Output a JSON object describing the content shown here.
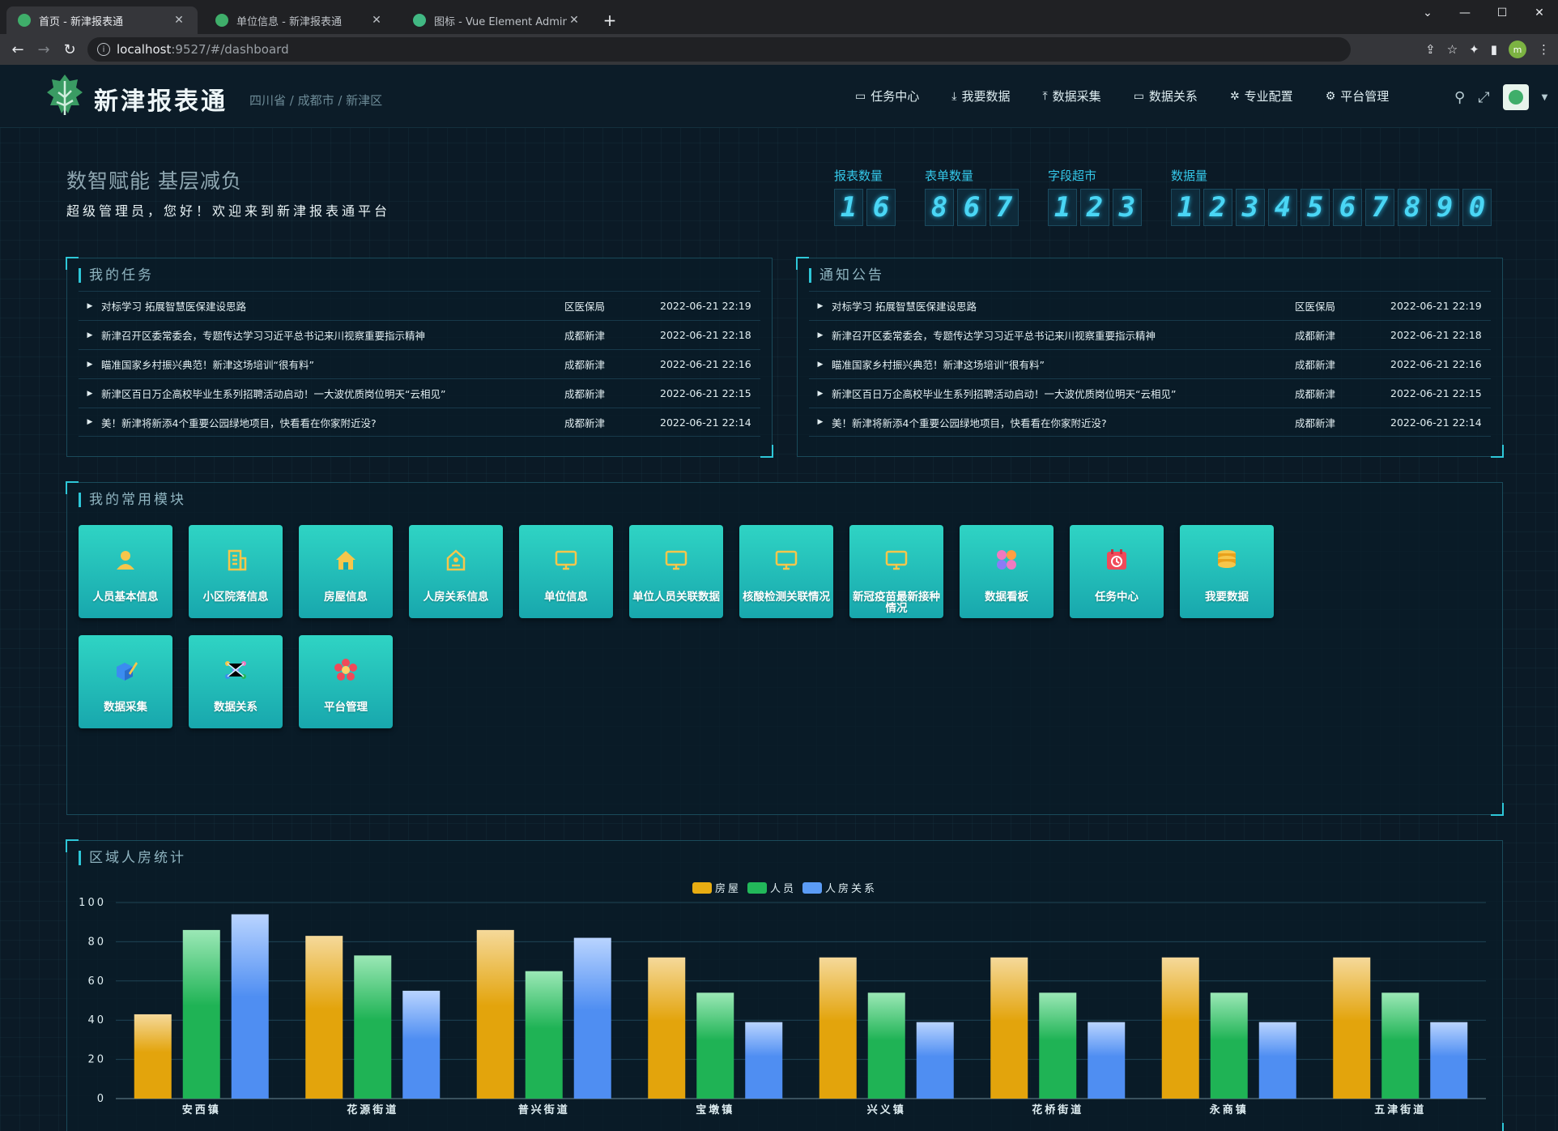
{
  "browser": {
    "tabs": [
      {
        "label": "首页 - 新津报表通",
        "active": true
      },
      {
        "label": "单位信息 - 新津报表通",
        "active": false
      },
      {
        "label": "图标 - Vue Element Admin",
        "active": false
      }
    ],
    "url_host": "localhost",
    "url_path": ":9527/#/dashboard",
    "profile_initial": "m"
  },
  "header": {
    "app_name": "新津报表通",
    "region": "四川省 / 成都市 / 新津区",
    "nav": [
      {
        "label": "任务中心",
        "icon": "monitor-icon"
      },
      {
        "label": "我要数据",
        "icon": "download-icon"
      },
      {
        "label": "数据采集",
        "icon": "upload-icon"
      },
      {
        "label": "数据关系",
        "icon": "monitor-icon"
      },
      {
        "label": "专业配置",
        "icon": "settings-icon"
      },
      {
        "label": "平台管理",
        "icon": "gear-icon"
      }
    ]
  },
  "welcome": {
    "slogan": "数智赋能 基层减负",
    "greeting": "超级管理员，您好！欢迎来到新津报表通平台"
  },
  "counters": [
    {
      "label": "报表数量",
      "digits": [
        "1",
        "6"
      ]
    },
    {
      "label": "表单数量",
      "digits": [
        "8",
        "6",
        "7"
      ]
    },
    {
      "label": "字段超市",
      "digits": [
        "1",
        "2",
        "3"
      ]
    },
    {
      "label": "数据量",
      "digits": [
        "1",
        "2",
        "3",
        "4",
        "5",
        "6",
        "7",
        "8",
        "9",
        "0"
      ]
    }
  ],
  "tasks": {
    "title": "我的任务",
    "rows": [
      {
        "title": "对标学习 拓展智慧医保建设思路",
        "org": "区医保局",
        "time": "2022-06-21 22:19"
      },
      {
        "title": "新津召开区委常委会，专题传达学习习近平总书记来川视察重要指示精神",
        "org": "成都新津",
        "time": "2022-06-21 22:18"
      },
      {
        "title": "瞄准国家乡村振兴典范！新津这场培训“很有料”",
        "org": "成都新津",
        "time": "2022-06-21 22:16"
      },
      {
        "title": "新津区百日万企高校毕业生系列招聘活动启动！一大波优质岗位明天“云相见”",
        "org": "成都新津",
        "time": "2022-06-21 22:15"
      },
      {
        "title": "美！新津将新添4个重要公园绿地项目，快看看在你家附近没?",
        "org": "成都新津",
        "time": "2022-06-21 22:14"
      }
    ]
  },
  "notices": {
    "title": "通知公告",
    "rows": [
      {
        "title": "对标学习 拓展智慧医保建设思路",
        "org": "区医保局",
        "time": "2022-06-21 22:19"
      },
      {
        "title": "新津召开区委常委会，专题传达学习习近平总书记来川视察重要指示精神",
        "org": "成都新津",
        "time": "2022-06-21 22:18"
      },
      {
        "title": "瞄准国家乡村振兴典范！新津这场培训“很有料”",
        "org": "成都新津",
        "time": "2022-06-21 22:16"
      },
      {
        "title": "新津区百日万企高校毕业生系列招聘活动启动！一大波优质岗位明天“云相见”",
        "org": "成都新津",
        "time": "2022-06-21 22:15"
      },
      {
        "title": "美！新津将新添4个重要公园绿地项目，快看看在你家附近没?",
        "org": "成都新津",
        "time": "2022-06-21 22:14"
      }
    ]
  },
  "modules": {
    "title": "我的常用模块",
    "items": [
      {
        "label": "人员基本信息",
        "icon": "person-icon"
      },
      {
        "label": "小区院落信息",
        "icon": "building-icon"
      },
      {
        "label": "房屋信息",
        "icon": "house-icon"
      },
      {
        "label": "人房关系信息",
        "icon": "house-tag-icon"
      },
      {
        "label": "单位信息",
        "icon": "monitor-icon"
      },
      {
        "label": "单位人员关联数据",
        "icon": "monitor-icon"
      },
      {
        "label": "核酸检测关联情况",
        "icon": "monitor-icon"
      },
      {
        "label": "新冠疫苗最新接种情况",
        "icon": "monitor-icon"
      },
      {
        "label": "数据看板",
        "icon": "dashboard-blocks-icon"
      },
      {
        "label": "任务中心",
        "icon": "calendar-clock-icon"
      },
      {
        "label": "我要数据",
        "icon": "database-icon"
      },
      {
        "label": "数据采集",
        "icon": "cube-pencil-icon"
      },
      {
        "label": "数据关系",
        "icon": "network-icon"
      },
      {
        "label": "平台管理",
        "icon": "flower-gear-icon"
      }
    ]
  },
  "stats_title": "区域人房统计",
  "colors": {
    "accent": "#2ec7d8",
    "house": "#e8ad12",
    "person": "#22b85a",
    "relation": "#5b9cf5"
  },
  "chart_data": {
    "type": "bar",
    "categories": [
      "安西镇",
      "花源街道",
      "普兴街道",
      "宝墩镇",
      "兴义镇",
      "花桥街道",
      "永商镇",
      "五津街道"
    ],
    "series": [
      {
        "name": "房屋",
        "values": [
          43,
          83,
          86,
          72,
          72,
          72,
          72,
          72
        ]
      },
      {
        "name": "人员",
        "values": [
          86,
          73,
          65,
          54,
          54,
          54,
          54,
          54
        ]
      },
      {
        "name": "人房关系",
        "values": [
          94,
          55,
          82,
          39,
          39,
          39,
          39,
          39
        ]
      }
    ],
    "ylim": [
      0,
      100
    ],
    "yticks": [
      "0",
      "20",
      "40",
      "60",
      "80",
      "100"
    ],
    "legend_position": "top-center",
    "grid": true
  }
}
